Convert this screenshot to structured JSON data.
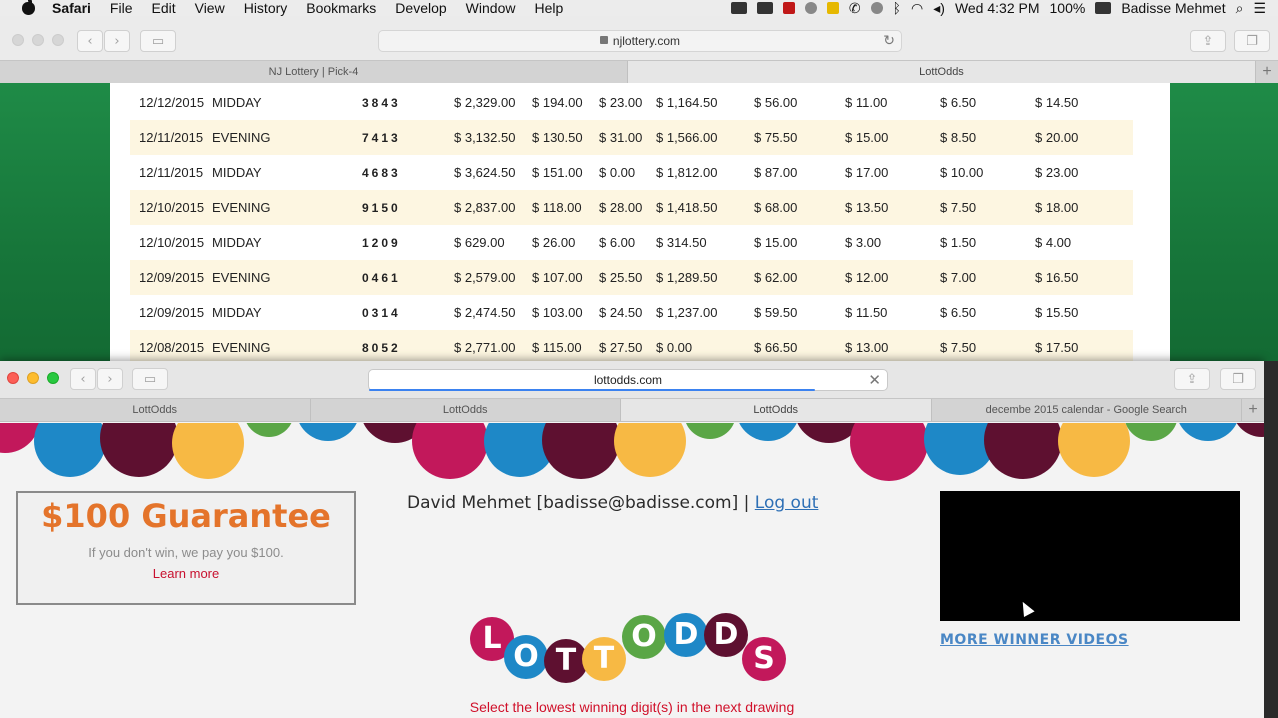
{
  "menubar": {
    "app": "Safari",
    "items": [
      "File",
      "Edit",
      "View",
      "History",
      "Bookmarks",
      "Develop",
      "Window",
      "Help"
    ],
    "datetime": "Wed 4:32 PM",
    "battery": "100%",
    "user": "Badisse Mehmet"
  },
  "back_window": {
    "url": "njlottery.com",
    "tabs": [
      "NJ Lottery | Pick-4",
      "LottOdds"
    ],
    "rows": [
      {
        "date": "12/12/2015",
        "draw": "MIDDAY",
        "number": "3843",
        "m1": "$ 2,329.00",
        "m2": "$ 194.00",
        "m3": "$ 23.00",
        "m4": "$ 1,164.50",
        "m5": "$ 56.00",
        "m6": "$ 11.00",
        "m7": "$ 6.50",
        "m8": "$ 14.50"
      },
      {
        "date": "12/11/2015",
        "draw": "EVENING",
        "number": "7413",
        "m1": "$ 3,132.50",
        "m2": "$ 130.50",
        "m3": "$ 31.00",
        "m4": "$ 1,566.00",
        "m5": "$ 75.50",
        "m6": "$ 15.00",
        "m7": "$ 8.50",
        "m8": "$ 20.00"
      },
      {
        "date": "12/11/2015",
        "draw": "MIDDAY",
        "number": "4683",
        "m1": "$ 3,624.50",
        "m2": "$ 151.00",
        "m3": "$ 0.00",
        "m4": "$ 1,812.00",
        "m5": "$ 87.00",
        "m6": "$ 17.00",
        "m7": "$ 10.00",
        "m8": "$ 23.00"
      },
      {
        "date": "12/10/2015",
        "draw": "EVENING",
        "number": "9150",
        "m1": "$ 2,837.00",
        "m2": "$ 118.00",
        "m3": "$ 28.00",
        "m4": "$ 1,418.50",
        "m5": "$ 68.00",
        "m6": "$ 13.50",
        "m7": "$ 7.50",
        "m8": "$ 18.00"
      },
      {
        "date": "12/10/2015",
        "draw": "MIDDAY",
        "number": "1209",
        "m1": "$ 629.00",
        "m2": "$ 26.00",
        "m3": "$ 6.00",
        "m4": "$ 314.50",
        "m5": "$ 15.00",
        "m6": "$ 3.00",
        "m7": "$ 1.50",
        "m8": "$ 4.00"
      },
      {
        "date": "12/09/2015",
        "draw": "EVENING",
        "number": "0461",
        "m1": "$ 2,579.00",
        "m2": "$ 107.00",
        "m3": "$ 25.50",
        "m4": "$ 1,289.50",
        "m5": "$ 62.00",
        "m6": "$ 12.00",
        "m7": "$ 7.00",
        "m8": "$ 16.50"
      },
      {
        "date": "12/09/2015",
        "draw": "MIDDAY",
        "number": "0314",
        "m1": "$ 2,474.50",
        "m2": "$ 103.00",
        "m3": "$ 24.50",
        "m4": "$ 1,237.00",
        "m5": "$ 59.50",
        "m6": "$ 11.50",
        "m7": "$ 6.50",
        "m8": "$ 15.50"
      },
      {
        "date": "12/08/2015",
        "draw": "EVENING",
        "number": "8052",
        "m1": "$ 2,771.00",
        "m2": "$ 115.00",
        "m3": "$ 27.50",
        "m4": "$ 0.00",
        "m5": "$ 66.50",
        "m6": "$ 13.00",
        "m7": "$ 7.50",
        "m8": "$ 17.50"
      }
    ]
  },
  "front_window": {
    "url": "lottodds.com",
    "tabs": [
      "LottOdds",
      "LottOdds",
      "LottOdds",
      "decembe 2015 calendar - Google Search"
    ],
    "active_tab": 2,
    "guarantee": {
      "headline": "$100 Guarantee",
      "sub": "If you don't win, we pay you $100.",
      "link": "Learn more"
    },
    "user": {
      "text": "David Mehmet [badisse@badisse.com] |",
      "logout": "Log out"
    },
    "more_videos": "MORE WINNER VIDEOS",
    "logo_letters": [
      "L",
      "O",
      "T",
      "T",
      "O",
      "D",
      "D",
      "S"
    ],
    "tagline": "Select the lowest winning digit(s) in the next drawing"
  },
  "colors": {
    "green_bg": "#1f8b47",
    "row_alt": "#fdf6e1",
    "orange": "#e4742b",
    "red": "#c8102e",
    "link_blue": "#2d6fb5",
    "maroon": "#5e1030",
    "magenta": "#c2185b",
    "blue": "#1e88c7",
    "yellow": "#f7b944",
    "leaf_green": "#5aa646"
  }
}
